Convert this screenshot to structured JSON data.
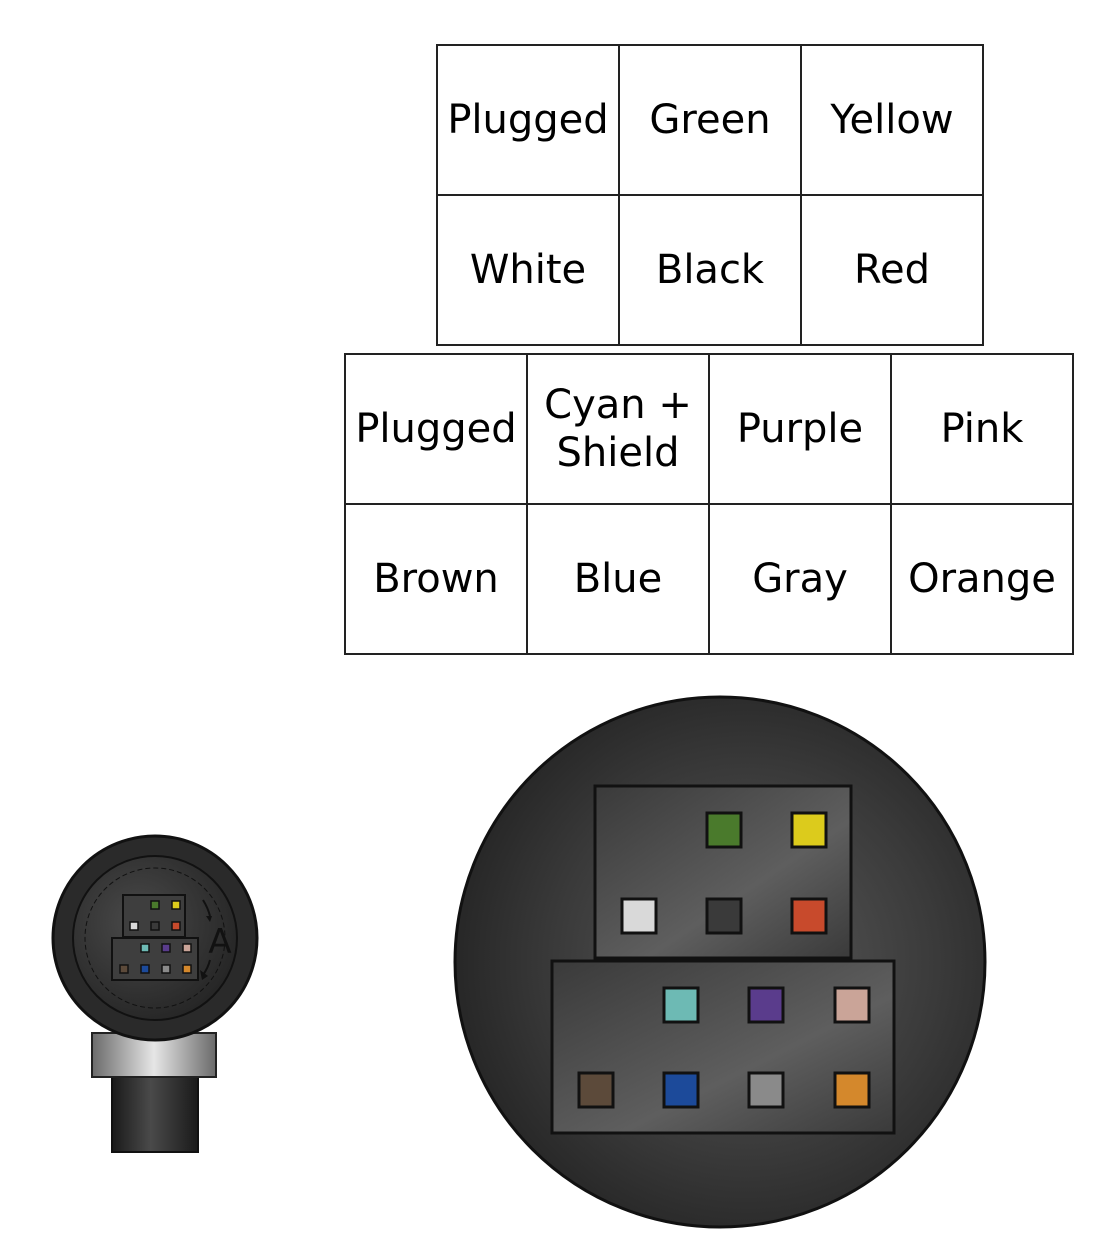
{
  "top_grid": {
    "rows": [
      [
        "Plugged",
        "Green",
        "Yellow"
      ],
      [
        "White",
        "Black",
        "Red"
      ]
    ]
  },
  "bottom_grid": {
    "rows": [
      [
        "Plugged",
        "Cyan +\nShield",
        "Purple",
        "Pink"
      ],
      [
        "Brown",
        "Blue",
        "Gray",
        "Orange"
      ]
    ]
  },
  "small_connector": {
    "keying_letter": "A"
  },
  "pin_colors": {
    "green": "#4a7a2c",
    "yellow": "#dccb1c",
    "white": "#d9d9d9",
    "black": "#3a3a3a",
    "red": "#c84a2c",
    "cyan": "#6dbab4",
    "purple": "#5a3c8c",
    "pink": "#caa498",
    "brown": "#5c4a3a",
    "blue": "#1c4a9a",
    "gray": "#8a8a8a",
    "orange": "#d4882c"
  }
}
